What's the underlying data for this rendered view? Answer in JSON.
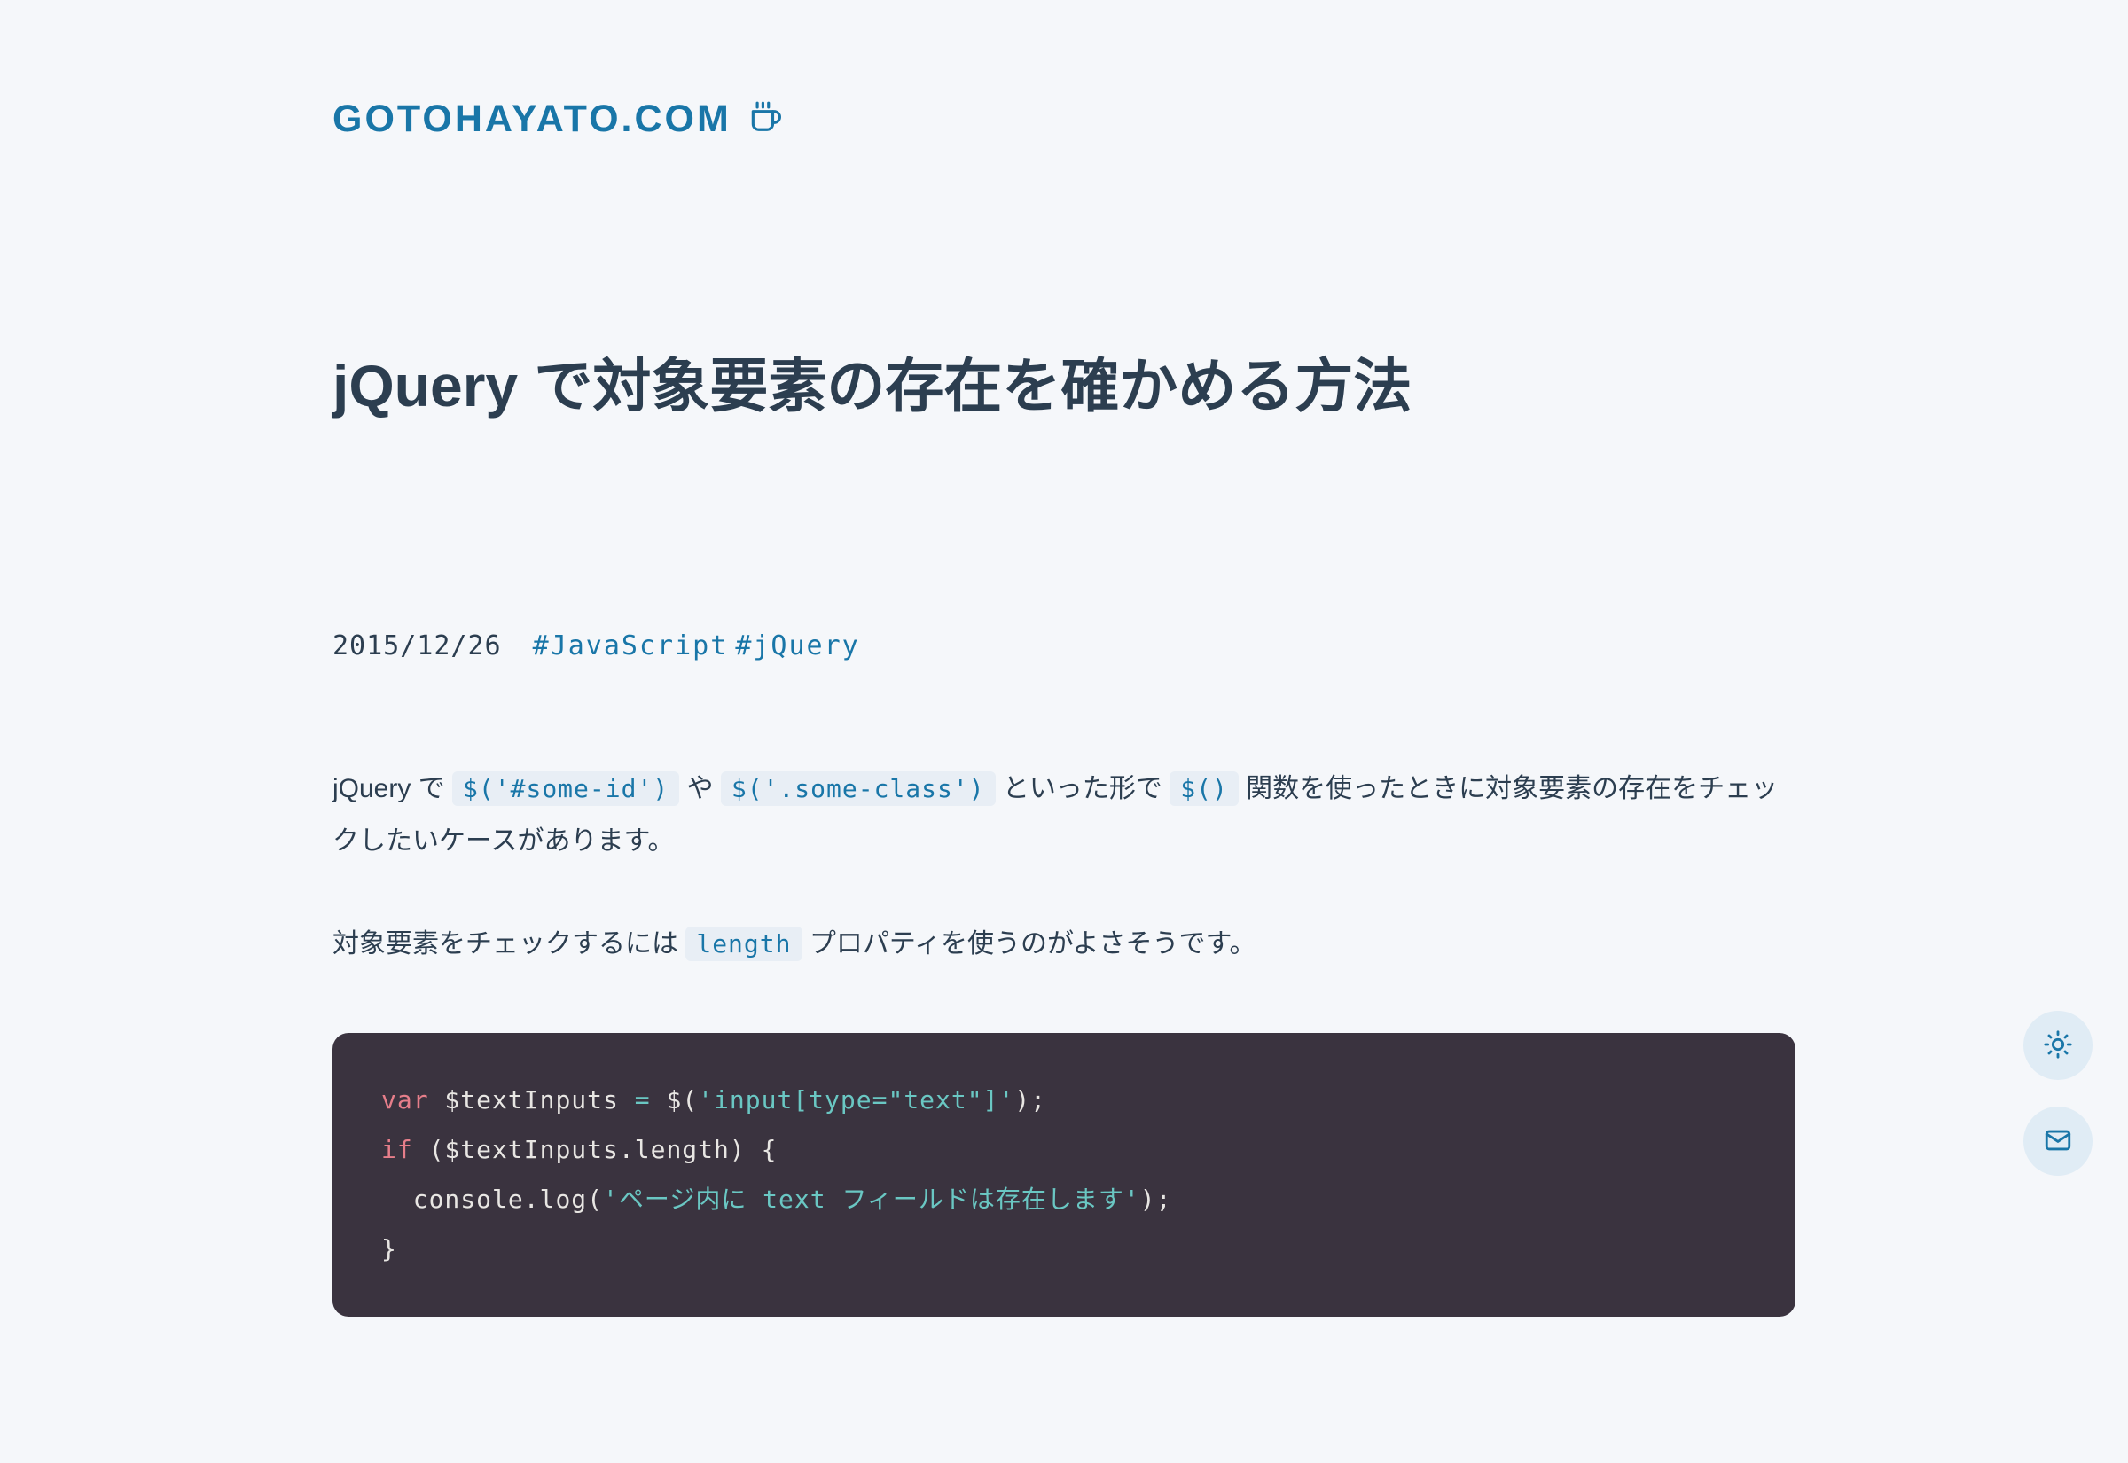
{
  "site": {
    "title": "GOTOHAYATO.COM"
  },
  "article": {
    "title": "jQuery で対象要素の存在を確かめる方法",
    "date": "2015/12/26",
    "tags": [
      "#JavaScript",
      "#jQuery"
    ]
  },
  "content": {
    "para1_pre": "jQuery で ",
    "para1_code1": "$('#some-id')",
    "para1_mid1": " や ",
    "para1_code2": "$('.some-class')",
    "para1_mid2": " といった形で ",
    "para1_code3": "$()",
    "para1_post": " 関数を使ったときに対象要素の存在をチェックしたいケースがあります。",
    "para2_pre": "対象要素をチェックするには ",
    "para2_code1": "length",
    "para2_post": " プロパティを使うのがよさそうです。"
  },
  "code": {
    "line1": {
      "var": "var",
      "name": " $textInputs ",
      "eq": "= ",
      "dollar": "$",
      "paren_open": "(",
      "str": "'input[type=\"text\"]'",
      "paren_close": ");"
    },
    "line2": {
      "if": "if",
      "cond_open": " (",
      "varname": "$textInputs",
      "dot": ".",
      "prop": "length",
      "cond_close": ") {"
    },
    "line3": {
      "indent": "  ",
      "console": "console",
      "dot": ".",
      "log": "log",
      "paren_open": "(",
      "str": "'ページ内に text フィールドは存在します'",
      "paren_close": ");"
    },
    "line4": {
      "brace": "}"
    }
  }
}
